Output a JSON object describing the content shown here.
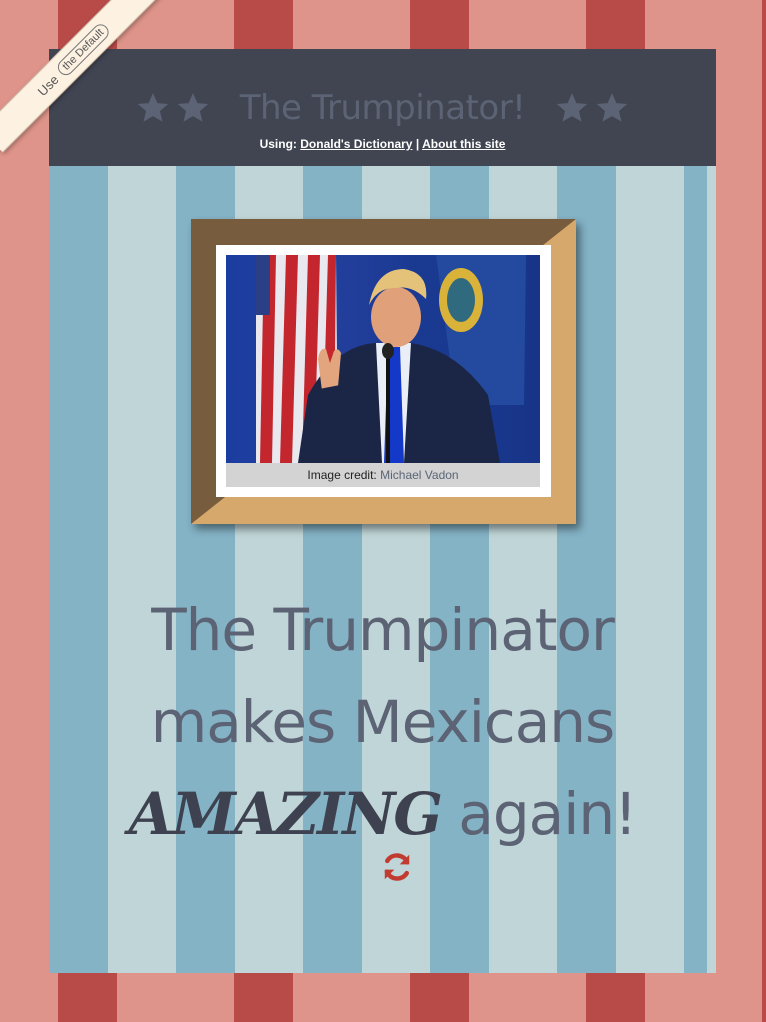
{
  "ribbon": {
    "prefix": "Use",
    "button": "the Default"
  },
  "header": {
    "title": "The Trumpinator!",
    "using_label": "Using:",
    "dictionary_link": "Donald's Dictionary",
    "separator": "|",
    "about_link": "About this site"
  },
  "image": {
    "credit_label": "Image credit:",
    "credit_name": "Michael Vadon"
  },
  "headline": {
    "line1": "The Trumpinator",
    "line2": "makes Mexicans",
    "emphasis": "AMAZING",
    "line3_rest": " again!"
  },
  "colors": {
    "header_bg": "#414552",
    "title_text": "#5b6374",
    "refresh_icon": "#c23b30",
    "outer_stripe_dark": "#b84a48",
    "outer_stripe_light": "#de948a",
    "inner_stripe_dark": "#84b3c6",
    "inner_stripe_light": "#c0d5d7"
  },
  "icons": [
    "star-icon",
    "refresh-icon"
  ]
}
